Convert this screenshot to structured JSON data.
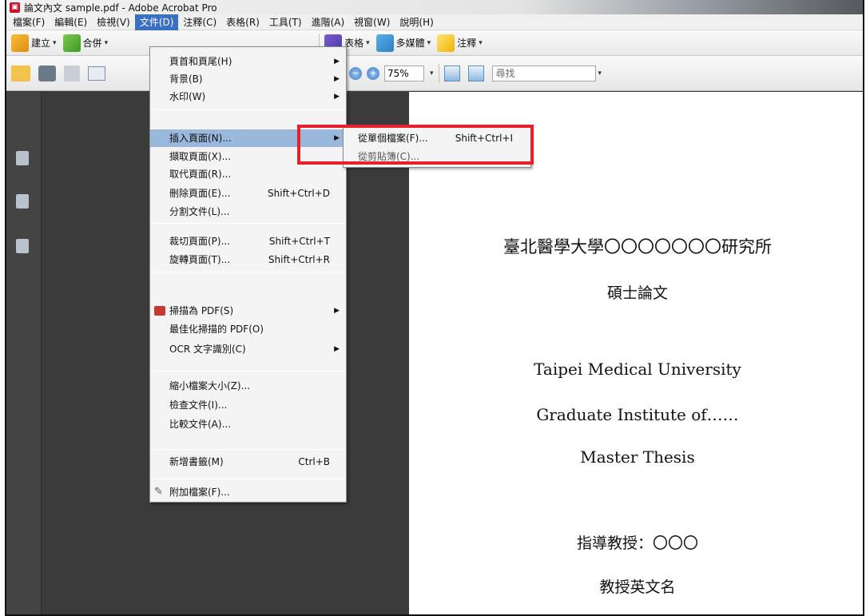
{
  "window": {
    "title": "論文內文 sample.pdf - Adobe Acrobat Pro"
  },
  "menubar": [
    "檔案(F)",
    "編輯(E)",
    "檢視(V)",
    "文件(D)",
    "注釋(C)",
    "表格(R)",
    "工具(T)",
    "進階(A)",
    "視窗(W)",
    "說明(H)"
  ],
  "toolbar1": {
    "create": "建立",
    "merge": "合併",
    "forms": "表格",
    "multimedia": "多媒體",
    "comment": "注釋"
  },
  "toolbar2": {
    "zoom": "75%",
    "search_placeholder": "尋找"
  },
  "document_menu": {
    "header_footer": "頁首和頁尾(H)",
    "background": "背景(B)",
    "watermark": "水印(W)",
    "insert_pages": "插入頁面(N)...",
    "extract_pages": "擷取頁面(X)...",
    "replace_pages": "取代頁面(R)...",
    "delete_pages": "刪除頁面(E)...",
    "delete_pages_shortcut": "Shift+Ctrl+D",
    "split_document": "分割文件(L)...",
    "crop_pages": "裁切頁面(P)...",
    "crop_pages_shortcut": "Shift+Ctrl+T",
    "rotate_pages": "旋轉頁面(T)...",
    "rotate_pages_shortcut": "Shift+Ctrl+R",
    "scan_to_pdf": "掃描為 PDF(S)",
    "optimize_scanned": "最佳化掃描的 PDF(O)",
    "ocr": "OCR 文字識別(C)",
    "reduce_size": "縮小檔案大小(Z)...",
    "examine_document": "檢查文件(I)...",
    "compare_documents": "比較文件(A)...",
    "new_bookmark": "新增書籤(M)",
    "new_bookmark_shortcut": "Ctrl+B",
    "attach_file": "附加檔案(F)..."
  },
  "insert_submenu": {
    "from_file": "從單個檔案(F)...",
    "from_file_shortcut": "Shift+Ctrl+I",
    "from_clipboard": "從剪貼簿(C)..."
  },
  "document_page": {
    "university_line": "臺北醫學大學〇〇〇〇〇〇〇研究所",
    "degree_zh": "碩士論文",
    "university_en": "Taipei Medical University",
    "institute_en": "Graduate Institute of……",
    "degree_en": "Master Thesis",
    "advisor": "指導教授：〇〇〇",
    "advisor_en": "教授英文名"
  },
  "highlight_color": "#e8202a",
  "menu_active_color": "#3a6fc4"
}
